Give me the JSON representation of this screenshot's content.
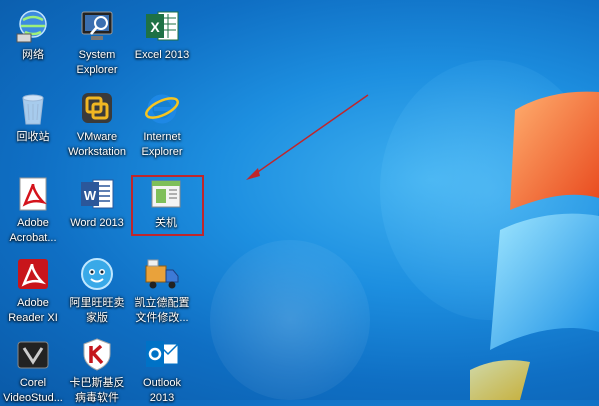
{
  "desktop": {
    "icons": [
      {
        "label": "网络",
        "icon": "network-icon"
      },
      {
        "label": "System\nExplorer",
        "icon": "system-explorer-icon"
      },
      {
        "label": "Excel 2013",
        "icon": "excel-icon"
      },
      {
        "label": "回收站",
        "icon": "recycle-bin-icon"
      },
      {
        "label": "VMware\nWorkstation",
        "icon": "vmware-icon"
      },
      {
        "label": "Internet\nExplorer",
        "icon": "ie-icon"
      },
      {
        "label": "Adobe\nAcrobat...",
        "icon": "acrobat-icon"
      },
      {
        "label": "Word 2013",
        "icon": "word-icon"
      },
      {
        "label": "关机",
        "icon": "shutdown-shortcut-icon"
      },
      {
        "label": "Adobe\nReader XI",
        "icon": "adobe-reader-icon"
      },
      {
        "label": "阿里旺旺卖\n家版",
        "icon": "aliwangwang-icon"
      },
      {
        "label": "凯立德配置\n文件修改...",
        "icon": "careland-icon"
      },
      {
        "label": "Corel\nVideoStud...",
        "icon": "corel-icon"
      },
      {
        "label": "卡巴斯基反\n病毒软件",
        "icon": "kaspersky-icon"
      },
      {
        "label": "Outlook\n2013",
        "icon": "outlook-icon"
      }
    ],
    "selected_icon": "关机",
    "colors": {
      "background": "#1d8fe0",
      "highlight_box": "#c0262b",
      "arrow": "#c0262b"
    }
  }
}
